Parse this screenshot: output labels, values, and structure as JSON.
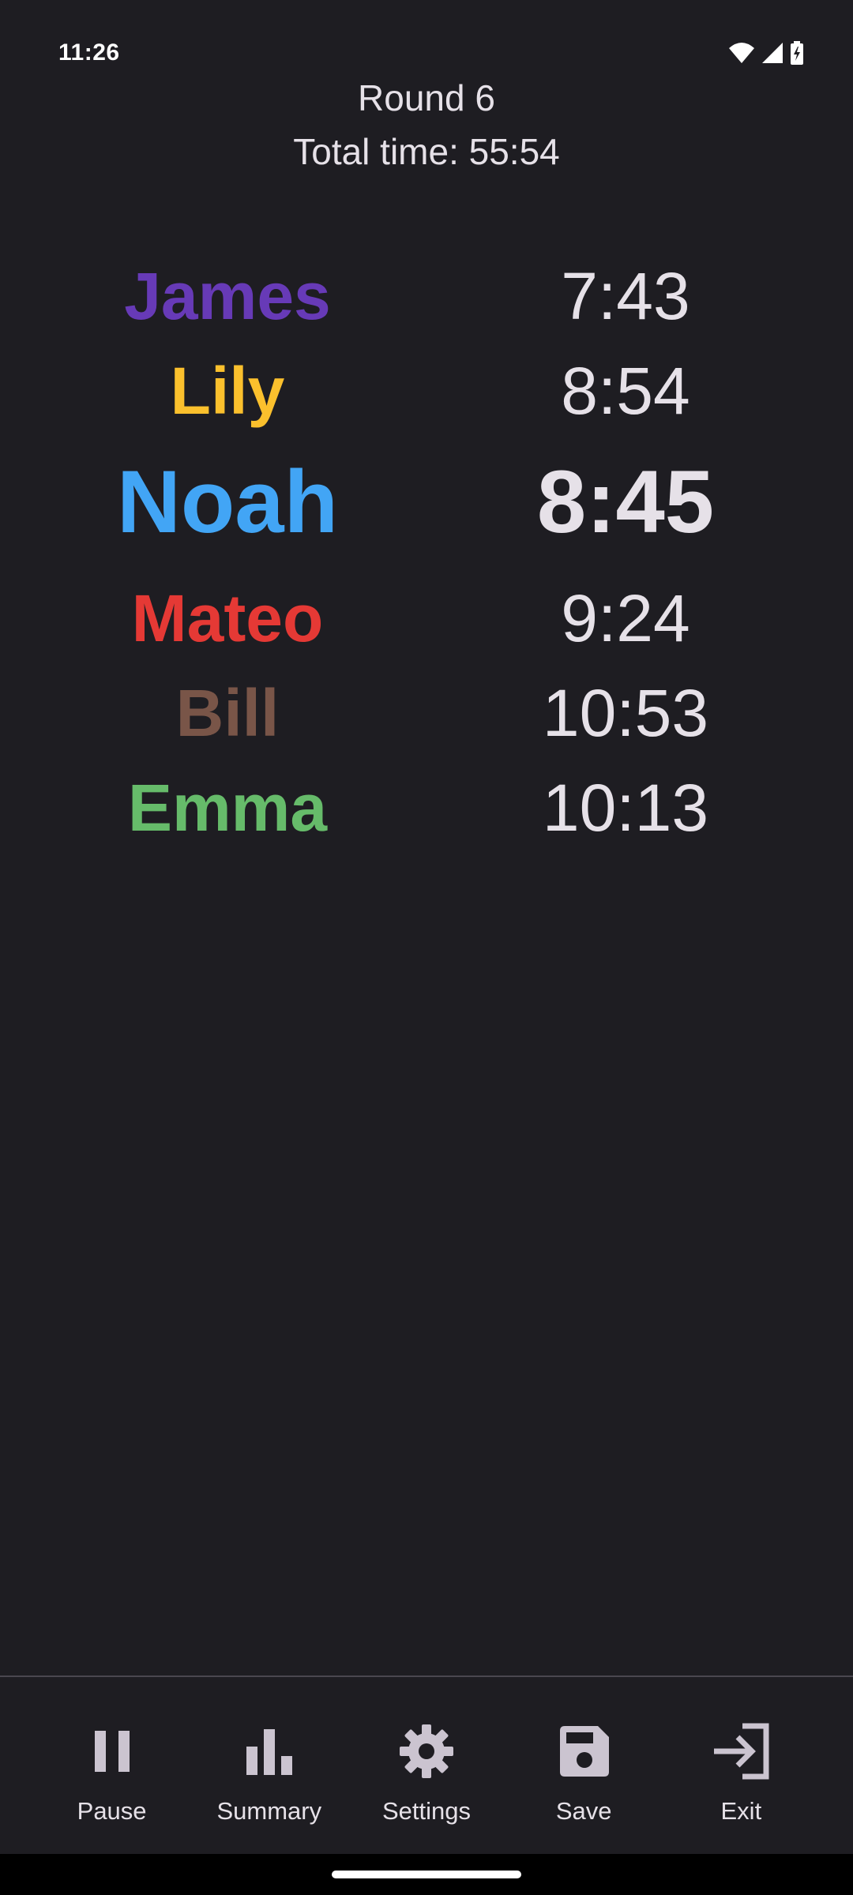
{
  "status_bar": {
    "time": "11:26",
    "icons": [
      "wifi-icon",
      "cell-signal-icon",
      "battery-charging-icon"
    ]
  },
  "header": {
    "round": "Round 6",
    "total_time": "Total time: 55:54"
  },
  "players": [
    {
      "name": "James",
      "time": "7:43",
      "color": "#673ab7",
      "active": false
    },
    {
      "name": "Lily",
      "time": "8:54",
      "color": "#fbc02d",
      "active": false
    },
    {
      "name": "Noah",
      "time": "8:45",
      "color": "#42a5f5",
      "active": true
    },
    {
      "name": "Mateo",
      "time": "9:24",
      "color": "#e53935",
      "active": false
    },
    {
      "name": "Bill",
      "time": "10:53",
      "color": "#795548",
      "active": false
    },
    {
      "name": "Emma",
      "time": "10:13",
      "color": "#66bb6a",
      "active": false
    }
  ],
  "nav": {
    "pause": {
      "label": "Pause",
      "icon": "pause-icon"
    },
    "summary": {
      "label": "Summary",
      "icon": "bar-chart-icon"
    },
    "settings": {
      "label": "Settings",
      "icon": "gear-icon"
    },
    "save": {
      "label": "Save",
      "icon": "save-icon"
    },
    "exit": {
      "label": "Exit",
      "icon": "exit-icon"
    }
  },
  "colors": {
    "background": "#1e1d22",
    "text": "#e6e1e8",
    "icon": "#cbc4d0"
  }
}
